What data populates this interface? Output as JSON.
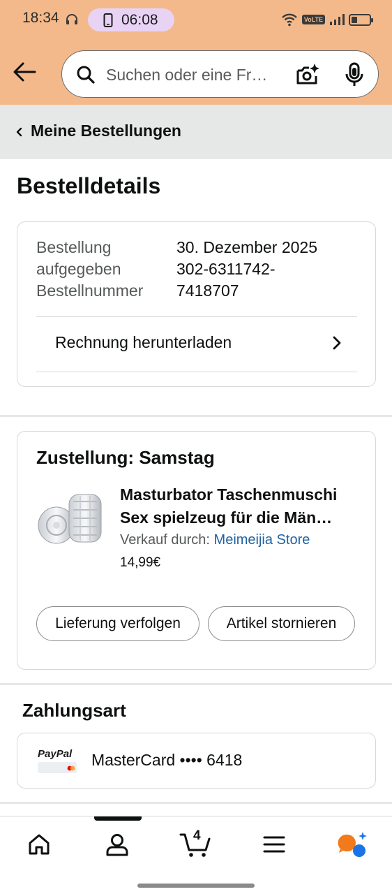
{
  "status_bar": {
    "time": "18:34",
    "call_timer": "06:08",
    "icons": [
      "headset-icon",
      "wifi-icon",
      "volte-icon",
      "signal-icon",
      "battery-icon"
    ],
    "volte_label": "VoLTE"
  },
  "header": {
    "back_icon": "back-arrow-icon",
    "search_placeholder": "Suchen oder eine Fr…",
    "search_value": "",
    "icons": [
      "search-icon",
      "camera-ai-icon",
      "microphone-icon"
    ]
  },
  "breadcrumb": {
    "label": "Meine Bestellungen"
  },
  "page_title": "Bestelldetails",
  "order_info": {
    "labels": [
      "Bestellung",
      "aufgegeben",
      "Bestellnummer"
    ],
    "date": "30. Dezember 2025",
    "number_line1": "302-6311742-",
    "number_line2": "7418707",
    "invoice_label": "Rechnung herunterladen"
  },
  "delivery": {
    "title": "Zustellung: Samstag",
    "product_title_line1": "Masturbator Taschenmuschi",
    "product_title_line2": "Sex spielzeug für die Män…",
    "seller_prefix": "Verkauf durch:",
    "seller_name": "Meimeijia Store",
    "price": "14,99€",
    "track_button": "Lieferung verfolgen",
    "cancel_button": "Artikel stornieren"
  },
  "payment": {
    "title": "Zahlungsart",
    "brand": "PayPal",
    "method": "MasterCard •••• 6418"
  },
  "bottom_nav": {
    "items": [
      "home-icon",
      "profile-icon",
      "cart-icon",
      "menu-icon",
      "rufus-icon"
    ],
    "cart_count": "4"
  },
  "colors": {
    "header_bg": "#f3b98a",
    "link": "#2162a1",
    "call_pill": "#e8d3f5",
    "rufus_orange": "#f27a1a",
    "rufus_blue": "#1b73e8"
  }
}
